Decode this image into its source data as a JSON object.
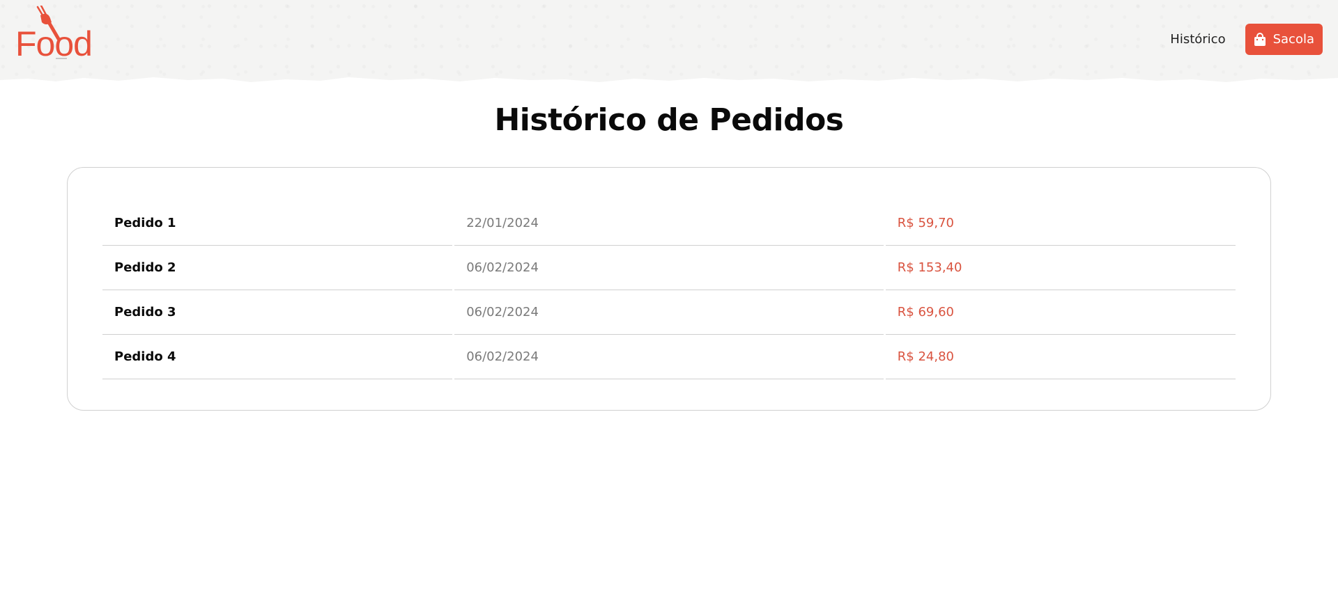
{
  "header": {
    "logo_text": "Food",
    "nav": {
      "history_label": "Histórico",
      "bag_label": "Sacola",
      "bag_icon": "shopping-bag-icon"
    }
  },
  "colors": {
    "brand": "#e8513b",
    "price": "#d9533f",
    "date": "#7a7a7a"
  },
  "main": {
    "title": "Histórico de Pedidos",
    "orders": [
      {
        "name": "Pedido 1",
        "date": "22/01/2024",
        "total": "R$ 59,70"
      },
      {
        "name": "Pedido 2",
        "date": "06/02/2024",
        "total": "R$ 153,40"
      },
      {
        "name": "Pedido 3",
        "date": "06/02/2024",
        "total": "R$ 69,60"
      },
      {
        "name": "Pedido 4",
        "date": "06/02/2024",
        "total": "R$ 24,80"
      }
    ]
  }
}
